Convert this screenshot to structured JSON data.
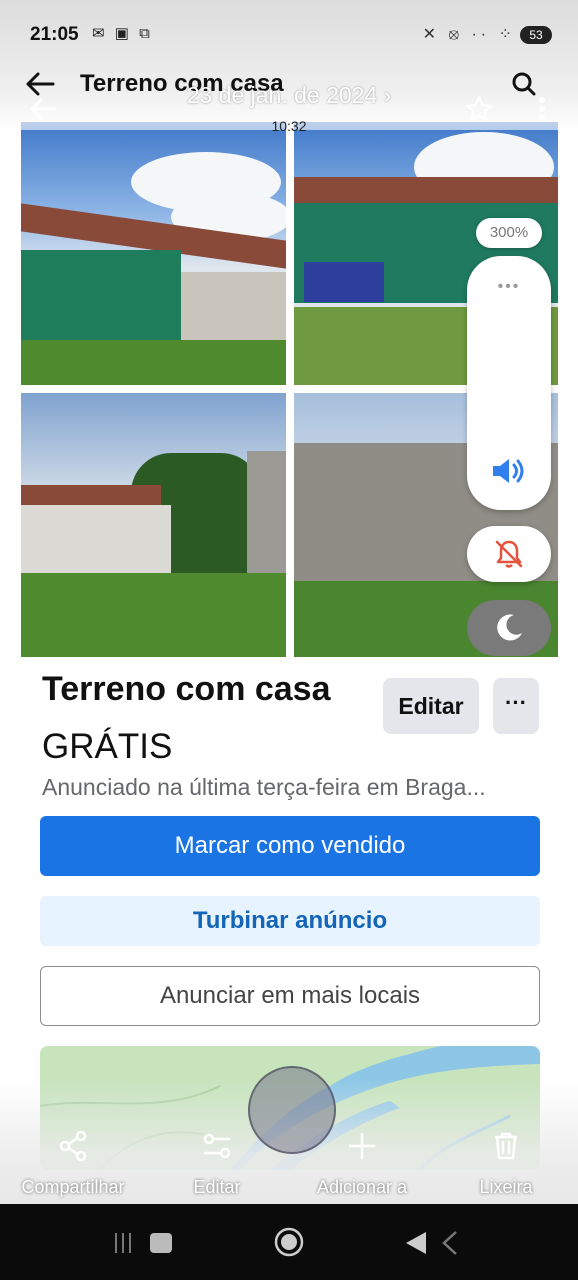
{
  "status_bar": {
    "time": "21:05",
    "battery": "53",
    "left_icons": "✉ ▣ ⧉",
    "right_icons": "✕ ⦻ ·· ⁘"
  },
  "app_bar": {
    "title": "Terreno com casa"
  },
  "gallery_overlay": {
    "date": "23 de jan. de 2024 ›",
    "time": "10:32"
  },
  "volume_overlay": {
    "level": "300%",
    "dots": "•••"
  },
  "listing": {
    "title": "Terreno com casa",
    "price": "GRÁTIS",
    "posted": "Anunciado na última terça-feira em Braga...",
    "edit_label": "Editar",
    "more_label": "···",
    "mark_sold_label": "Marcar como vendido",
    "boost_label": "Turbinar anúncio",
    "list_more_label": "Anunciar em mais locais"
  },
  "gallery_actions": [
    {
      "label": "Compartilhar",
      "icon": "share-icon"
    },
    {
      "label": "Editar",
      "icon": "edit-sliders-icon"
    },
    {
      "label": "Adicionar a",
      "icon": "plus-icon"
    },
    {
      "label": "Lixeira",
      "icon": "trash-icon"
    }
  ],
  "colors": {
    "primary": "#1b74e4",
    "boost_bg": "#e7f3ff",
    "boost_text": "#1464b8",
    "volume_accent": "#2f80ed",
    "mute_accent": "#e5533d"
  }
}
